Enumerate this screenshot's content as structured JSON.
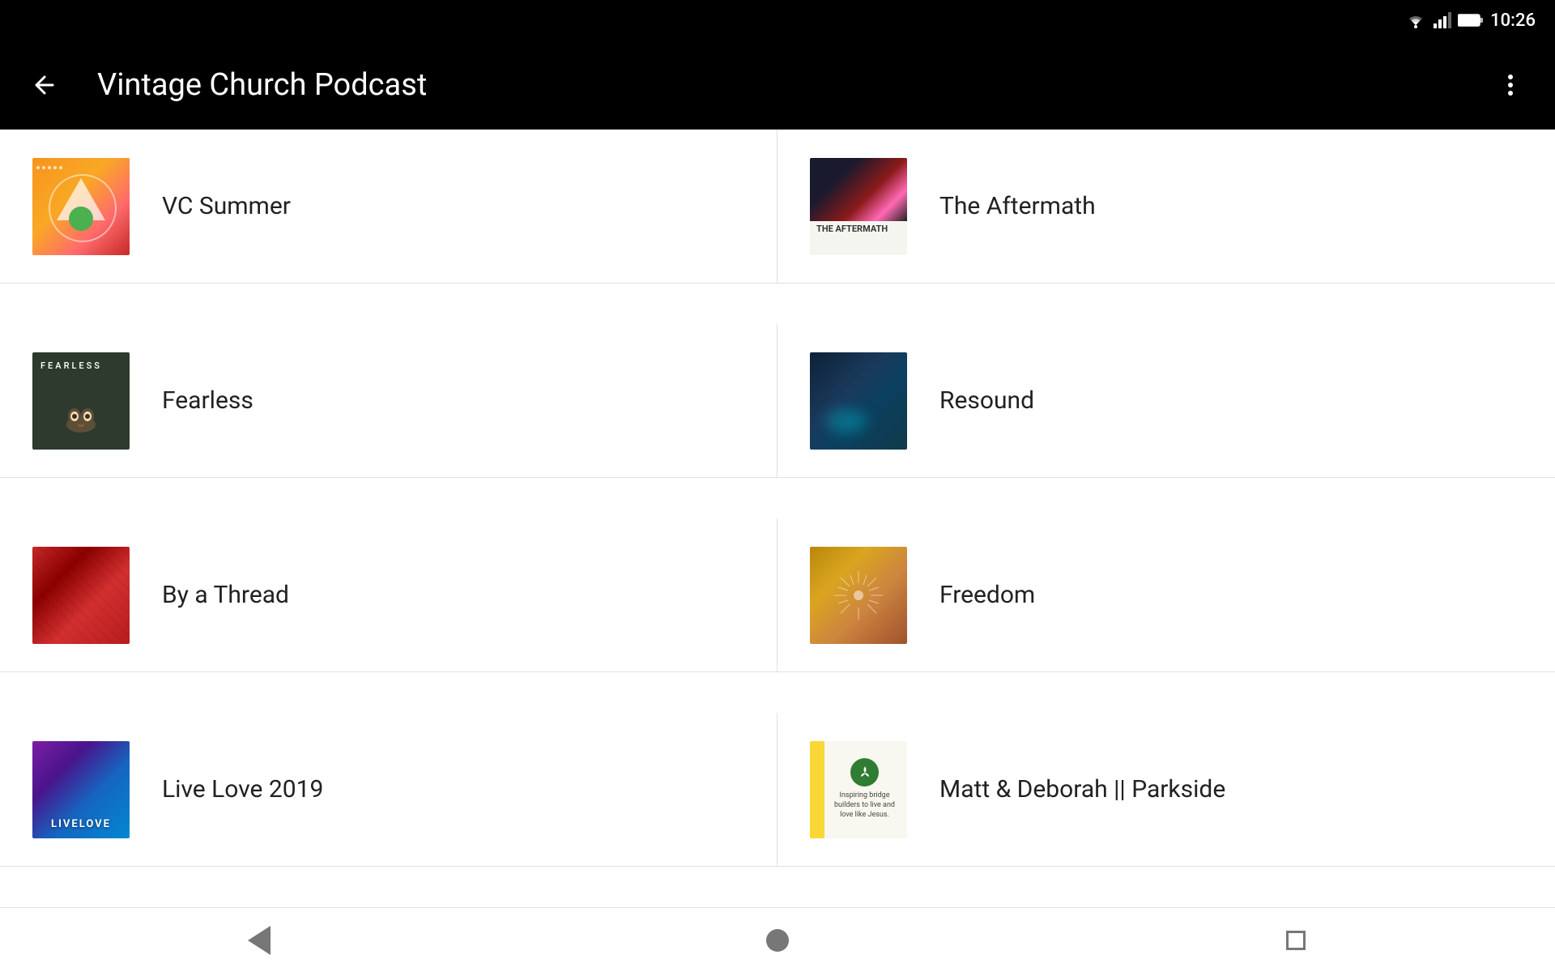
{
  "statusBar": {
    "time": "10:26"
  },
  "appBar": {
    "title": "Vintage Church Podcast",
    "backLabel": "←",
    "moreLabel": "⋮"
  },
  "podcasts": [
    {
      "id": "vc-summer",
      "name": "VC Summer",
      "thumb": "vc-summer"
    },
    {
      "id": "aftermath",
      "name": "The Aftermath",
      "thumb": "aftermath"
    },
    {
      "id": "fearless",
      "name": "Fearless",
      "thumb": "fearless"
    },
    {
      "id": "resound",
      "name": "Resound",
      "thumb": "resound"
    },
    {
      "id": "by-thread",
      "name": "By a Thread",
      "thumb": "by-thread"
    },
    {
      "id": "freedom",
      "name": "Freedom",
      "thumb": "freedom"
    },
    {
      "id": "livelove",
      "name": "Live Love 2019",
      "thumb": "livelove"
    },
    {
      "id": "parkside",
      "name": "Matt & Deborah || Parkside",
      "thumb": "parkside"
    }
  ],
  "navBar": {
    "backLabel": "",
    "homeLabel": "",
    "recentsLabel": ""
  }
}
